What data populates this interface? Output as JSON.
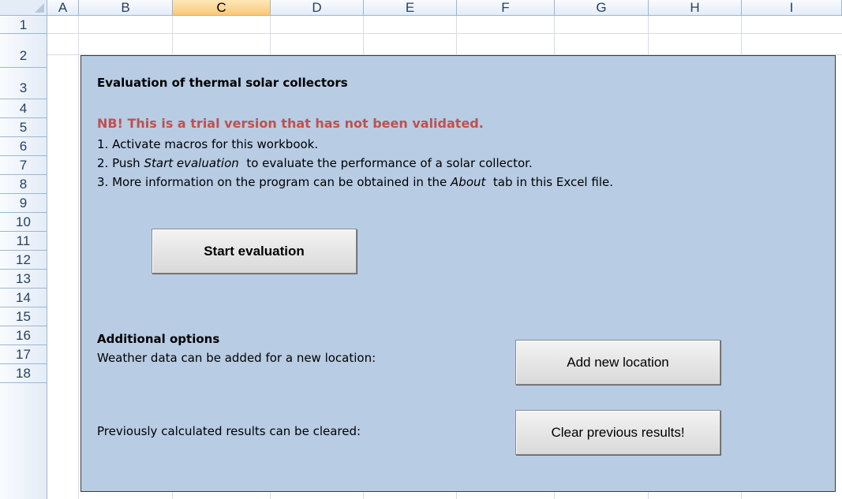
{
  "columns": [
    "A",
    "B",
    "C",
    "D",
    "E",
    "F",
    "G",
    "H",
    "I"
  ],
  "selected_column": "C",
  "rows": [
    "1",
    "2",
    "3",
    "4",
    "5",
    "6",
    "7",
    "8",
    "9",
    "10",
    "11",
    "12",
    "13",
    "14",
    "15",
    "16",
    "17",
    "18"
  ],
  "panel": {
    "title": "Evaluation of thermal solar collectors",
    "warning": "NB! This is a trial version that has not been validated.",
    "step1": "1. Activate macros for this workbook.",
    "step2_pre": "2. Push ",
    "step2_em": "Start evaluation",
    "step2_post": "  to evaluate the performance of a solar collector.",
    "step3_pre": "3. More information on the program can be obtained in the ",
    "step3_em": "About",
    "step3_post": "  tab in this Excel file.",
    "start_button": "Start evaluation",
    "additional_title": "Additional options",
    "weather_text": "Weather data can be added for a new location:",
    "add_location_button": "Add new location",
    "clear_text": "Previously calculated results can be cleared:",
    "clear_button": "Clear previous results!"
  }
}
